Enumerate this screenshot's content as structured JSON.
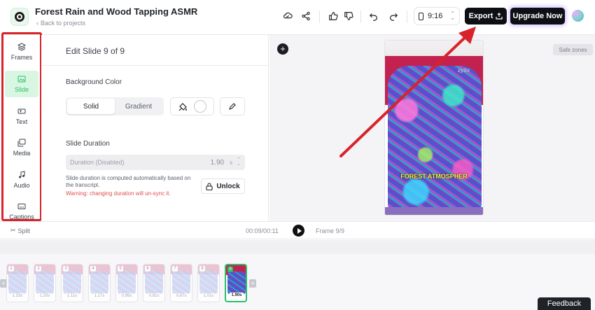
{
  "header": {
    "project_title": "Forest Rain and Wood Tapping ASMR",
    "back_link": "Back to projects",
    "aspect_ratio": "9:16",
    "export_label": "Export",
    "upgrade_label": "Upgrade Now"
  },
  "rail": {
    "items": [
      {
        "label": "Frames",
        "icon": "layers-icon"
      },
      {
        "label": "Slide",
        "icon": "slide-icon",
        "active": true
      },
      {
        "label": "Text",
        "icon": "text-icon"
      },
      {
        "label": "Media",
        "icon": "media-icon"
      },
      {
        "label": "Audio",
        "icon": "music-icon"
      },
      {
        "label": "Captions",
        "icon": "captions-icon"
      }
    ]
  },
  "panel": {
    "title": "Edit Slide 9 of 9",
    "background_color_label": "Background Color",
    "solid_label": "Solid",
    "gradient_label": "Gradient",
    "slide_duration_label": "Slide Duration",
    "duration_placeholder": "Duration (Disabled)",
    "duration_value": "1.90",
    "duration_unit": "s",
    "note": "Slide duration is computed automatically based on the transcript.",
    "warning": "Warning: changing duration will un-sync it.",
    "unlock_label": "Unlock"
  },
  "canvas": {
    "safe_zones_label": "Safe zones",
    "slide_caption": "FOREST ATMOSPHER",
    "slide_brand": "zylix"
  },
  "playback": {
    "split_label": "Split",
    "time": "00:09/00:11",
    "frame": "Frame 9/9"
  },
  "timeline": {
    "thumbs": [
      {
        "num": "1",
        "dur": "1.33s"
      },
      {
        "num": "2",
        "dur": "1.20s"
      },
      {
        "num": "3",
        "dur": "1.11s"
      },
      {
        "num": "4",
        "dur": "1.17s"
      },
      {
        "num": "5",
        "dur": "0.99s"
      },
      {
        "num": "6",
        "dur": "0.81s"
      },
      {
        "num": "7",
        "dur": "0.87s"
      },
      {
        "num": "8",
        "dur": "1.01s"
      },
      {
        "num": "9",
        "dur": "1.90s",
        "active": true
      }
    ]
  },
  "feedback_label": "Feedback",
  "colors": {
    "accent": "#2cbf68",
    "annotation": "#d8232a",
    "primary_button": "#0d0f14"
  }
}
